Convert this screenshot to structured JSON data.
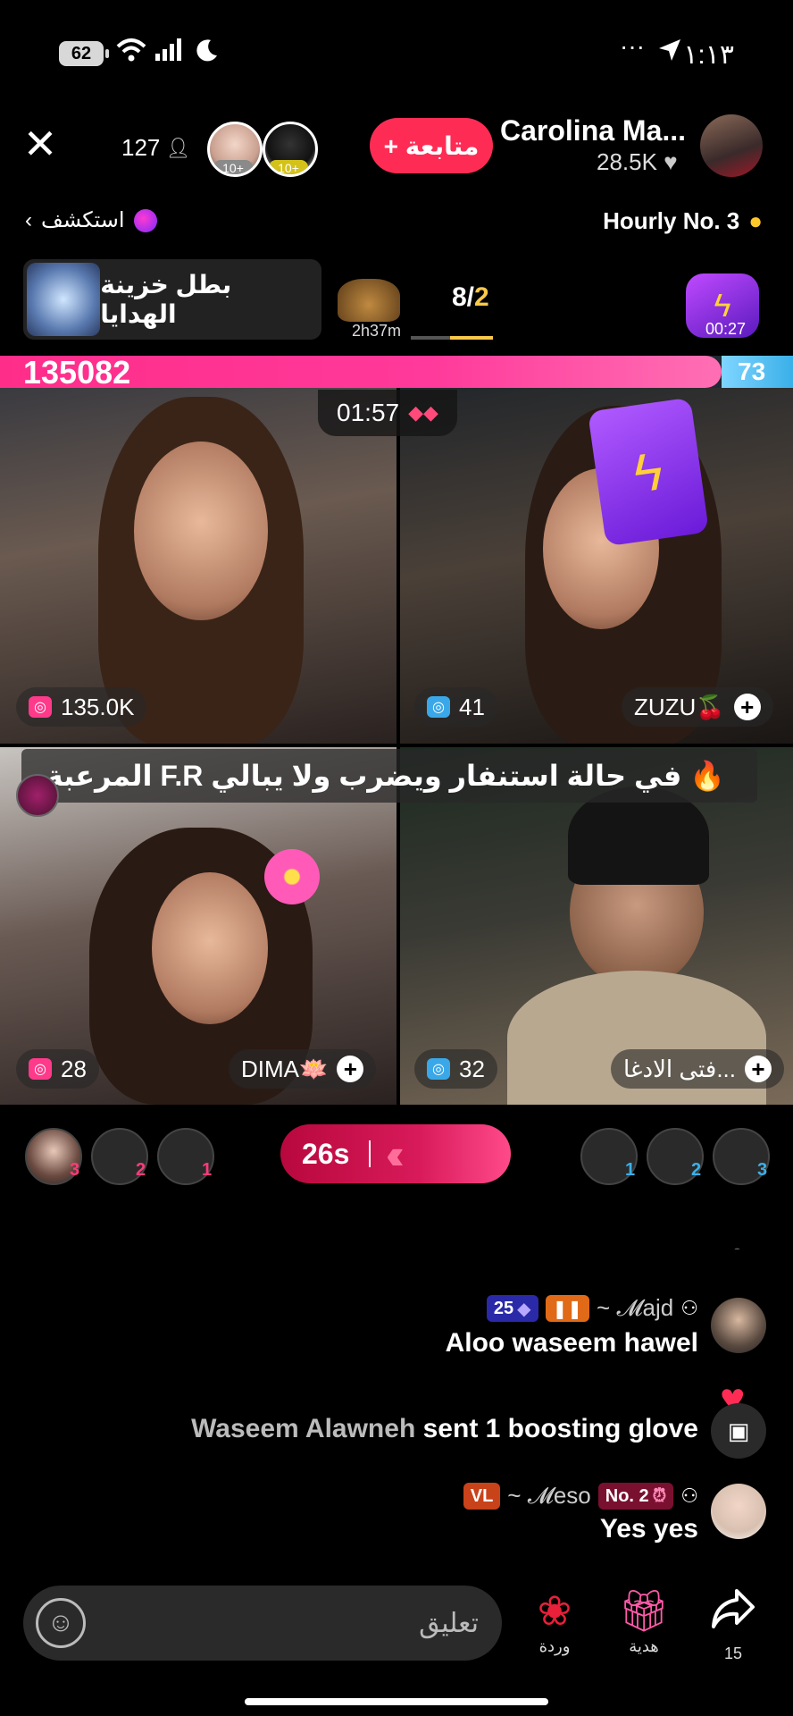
{
  "status_bar": {
    "battery": "62",
    "time": "١:١٣",
    "left_icons": [
      "wifi-icon",
      "signal-icon",
      "moon-icon"
    ],
    "right_icons": [
      "dots-icon",
      "location-arrow-icon"
    ]
  },
  "header": {
    "viewer_count": "127",
    "viewer_badges": [
      "10+",
      "10+"
    ],
    "follow_label": "+ متابعة",
    "host_name": "Carolina Ma...",
    "host_likes": "28.5K",
    "explore_label": "استكشف",
    "hourly_label": "Hourly No. 3"
  },
  "gift_row": {
    "title": "بطل خزينة الهدايا",
    "lion_time": "2h37m",
    "round_current": "2",
    "round_total": "8/",
    "pk_time": "00:27"
  },
  "battle": {
    "score_left": "135082",
    "score_right": "73",
    "timer": "01:57",
    "countdown": "26s",
    "colors": {
      "red_team": "#fe2c55",
      "blue_team": "#3ab0e8"
    }
  },
  "tiles": [
    {
      "count": "135.0K"
    },
    {
      "count": "41",
      "name": "ZUZU🍒"
    },
    {
      "count": "28",
      "name": "DIMA🪷"
    },
    {
      "count": "32",
      "name": "فتى الادغا..."
    }
  ],
  "banner": {
    "text": "المرعبة F.R في حالة استنفار ويضرب ولا يبالي 🔥"
  },
  "rankings": {
    "left": [
      "3",
      "2",
      "1"
    ],
    "right": [
      "1",
      "2",
      "3"
    ]
  },
  "chat": {
    "faded": "... ي",
    "messages": [
      {
        "user": "~ 𝓜ajd",
        "level": "25",
        "text": "Aloo waseem hawel"
      },
      {
        "user": "Waseem Alawneh",
        "text": "sent 1 boosting glove"
      },
      {
        "user": "~ 𝓜eso",
        "rank": "No. 2",
        "text": "Yes yes"
      }
    ]
  },
  "bottom": {
    "comment_placeholder": "تعليق",
    "rose_label": "وردة",
    "gift_label": "هدية",
    "share_count": "15"
  }
}
